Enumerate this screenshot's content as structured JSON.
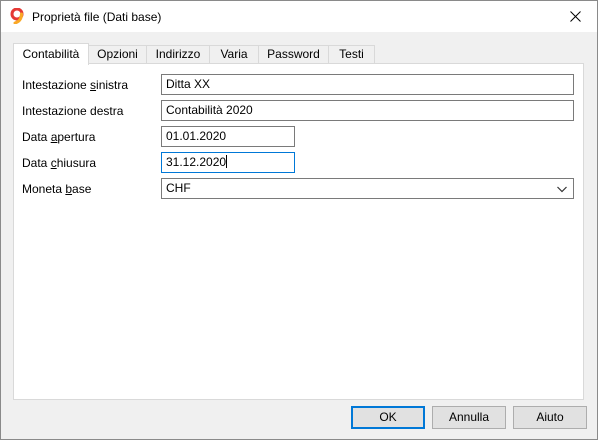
{
  "window": {
    "title": "Proprietà file (Dati base)",
    "icon": "app-logo-icon",
    "close_icon": "close-icon"
  },
  "tabs": [
    {
      "label": "Contabilità",
      "active": true
    },
    {
      "label": "Opzioni",
      "active": false
    },
    {
      "label": "Indirizzo",
      "active": false
    },
    {
      "label": "Varia",
      "active": false
    },
    {
      "label": "Password",
      "active": false
    },
    {
      "label": "Testi",
      "active": false
    }
  ],
  "form": {
    "header_left": {
      "label_pre": "Intestazione ",
      "label_u": "s",
      "label_post": "inistra",
      "value": "Ditta XX"
    },
    "header_right": {
      "label_pre": "Intestazione destra",
      "label_u": "",
      "label_post": "",
      "value": "Contabilità 2020"
    },
    "opening_date": {
      "label_pre": "Data ",
      "label_u": "a",
      "label_post": "pertura",
      "value": "01.01.2020"
    },
    "closing_date": {
      "label_pre": "Data ",
      "label_u": "c",
      "label_post": "hiusura",
      "value": "31.12.2020"
    },
    "base_currency": {
      "label_pre": "Moneta ",
      "label_u": "b",
      "label_post": "ase",
      "value": "CHF"
    }
  },
  "buttons": {
    "ok": "OK",
    "cancel": "Annulla",
    "help": "Aiuto"
  },
  "colors": {
    "accent": "#0078d7",
    "logo_red": "#e53935",
    "logo_orange": "#f9a825"
  }
}
